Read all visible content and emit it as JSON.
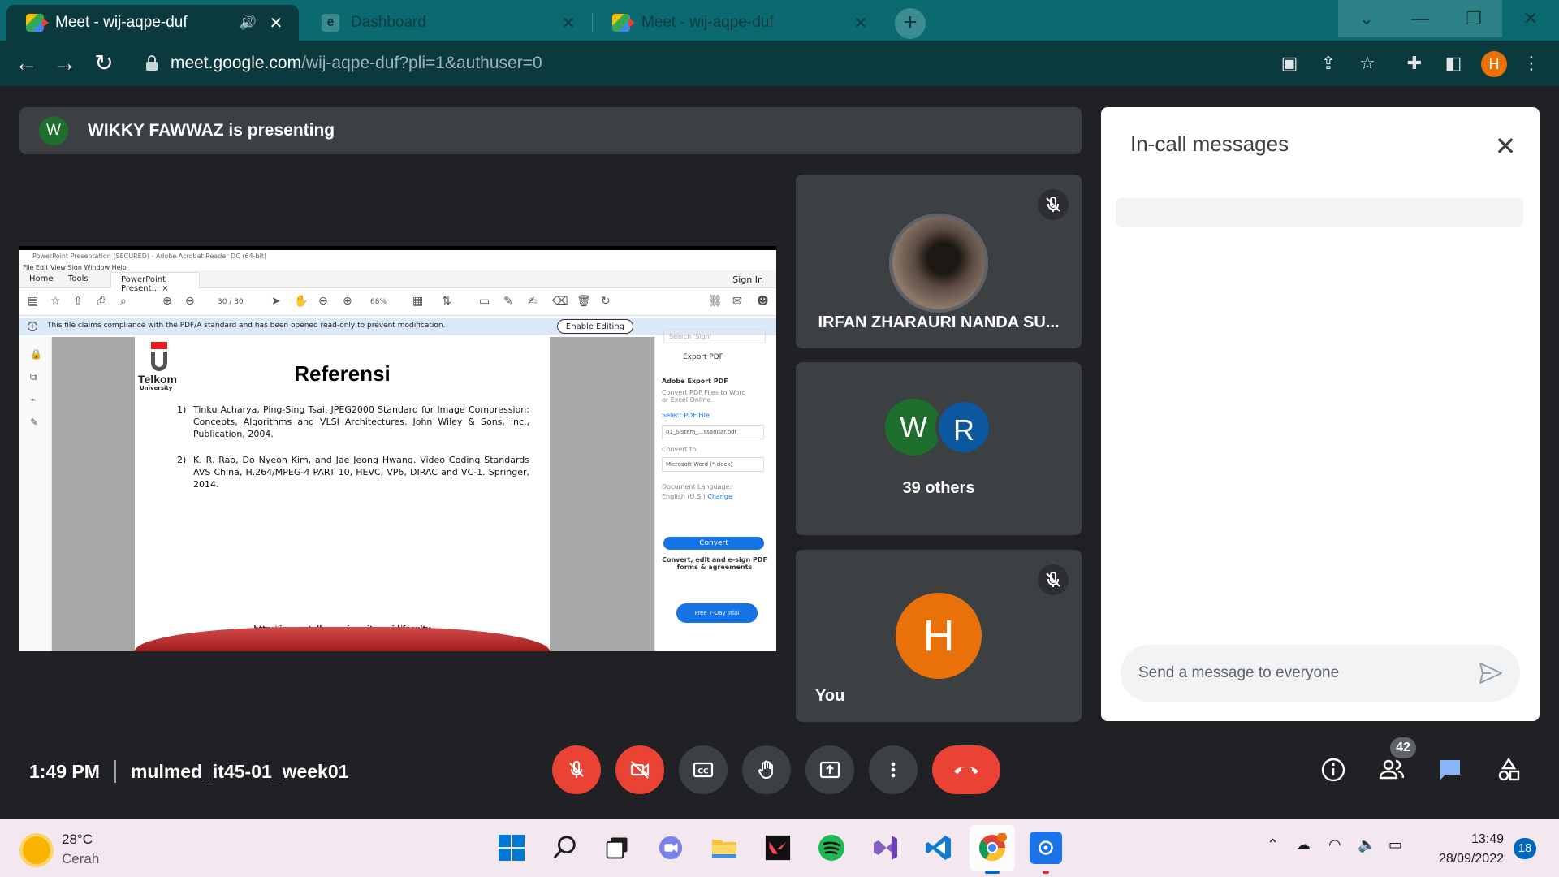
{
  "browser": {
    "tabs": [
      {
        "title": "Meet - wij-aqpe-duf",
        "favicon": "google-meet-icon",
        "active": true
      },
      {
        "title": "Dashboard",
        "favicon": "dashboard-icon",
        "active": false
      },
      {
        "title": "Meet - wij-aqpe-duf",
        "favicon": "google-meet-icon",
        "active": false
      }
    ],
    "url_host": "meet.google.com",
    "url_path": "/wij-aqpe-duf?pli=1&authuser=0",
    "profile_initial": "H"
  },
  "meet": {
    "presenter_initial": "W",
    "presenting_text": "WIKKY FAWWAZ is presenting",
    "participants": {
      "tile1_name": "IRFAN ZHARAURI NANDA SU...",
      "tile2_initial_a": "W",
      "tile2_initial_b": "R",
      "tile2_label": "39 others",
      "self_initial": "H",
      "self_label": "You"
    },
    "chat": {
      "title": "In-call messages",
      "input_placeholder": "Send a message to everyone"
    },
    "time": "1:49 PM",
    "meeting_name": "mulmed_it45-01_week01",
    "people_count": "42",
    "colors": {
      "leave_red": "#ea4335",
      "self_avatar": "#e8710a",
      "accent_blue": "#1a73e8"
    }
  },
  "shared_screen": {
    "window_title": "PowerPoint Presentation (SECURED) - Adobe Acrobat Reader DC (64-bit)",
    "menu": "File   Edit   View   Sign   Window   Help",
    "tab_home": "Home",
    "tab_tools": "Tools",
    "tab_doc": "PowerPoint Present... ×",
    "sign_in": "Sign In",
    "page_indicator": "30  /  30",
    "zoom": "68%",
    "notice": "This file claims compliance with the PDF/A standard and has been opened read-only to prevent modification.",
    "enable_editing": "Enable Editing",
    "logo_text": "Telkom",
    "logo_sub": "University",
    "slide_title": "Referensi",
    "ref1_num": "1)",
    "ref1": "Tinku Acharya, Ping-Sing Tsai. JPEG2000 Standard for Image Compression: Concepts, Algorithms and VLSI Architectures. John Wiley & Sons, inc., Publication, 2004.",
    "ref2_num": "2)",
    "ref2": "K. R. Rao, Do Nyeon Kim, and Jae Jeong Hwang. Video Coding Standards AVS China, H.264/MPEG-4 PART 10, HEVC, VP6, DIRAC and VC-1. Springer, 2014.",
    "footer_url": "http://icm.rg.telkomuniversity.ac.id/faculty",
    "side_search": "Search 'Sign'",
    "side_export": "Export PDF",
    "side_adobe_export": "Adobe Export PDF",
    "side_desc": "Convert PDF Files to Word or Excel Online",
    "side_select": "Select PDF File",
    "side_file": "01_Sistem_...ssandar.pdf",
    "side_convert_to": "Convert to",
    "side_format": "Microsoft Word (*.docx)",
    "side_lang_label": "Document Language:",
    "side_lang": "English (U.S.)",
    "side_change": "Change",
    "side_convert_btn": "Convert",
    "side_promo": "Convert, edit and e-sign PDF forms & agreements",
    "side_trial": "Free 7-Day Trial"
  },
  "taskbar": {
    "temp": "28°C",
    "condition": "Cerah",
    "time": "13:49",
    "date": "28/09/2022",
    "notifications": "18"
  }
}
